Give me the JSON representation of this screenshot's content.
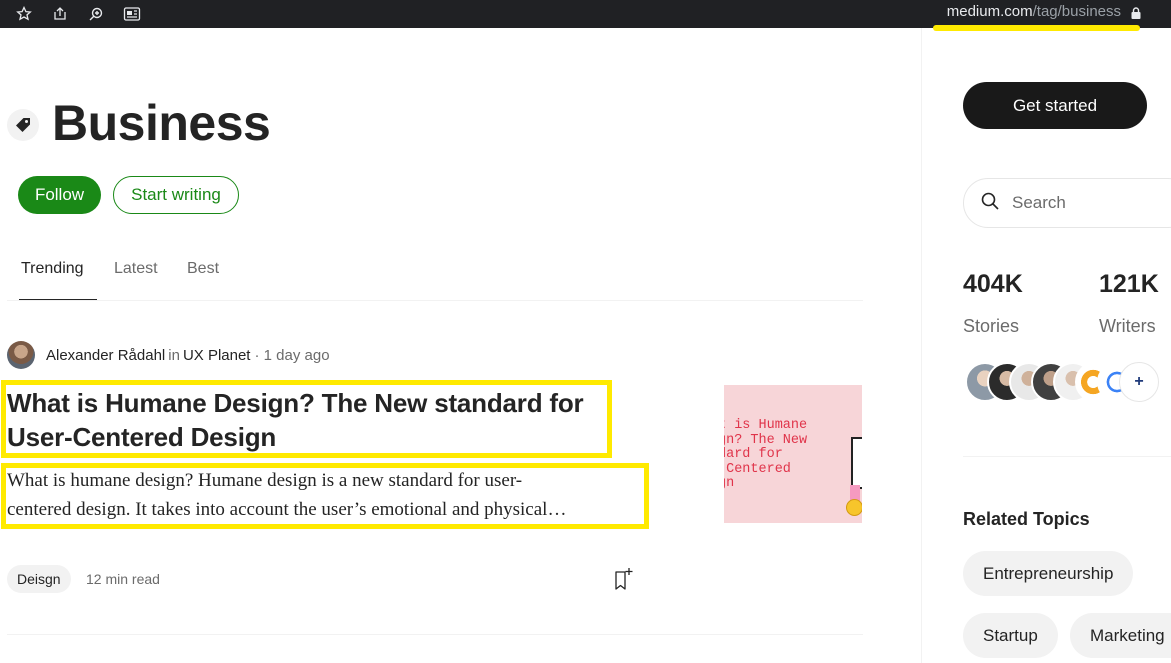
{
  "browser": {
    "url_domain": "medium.com",
    "url_path": "/tag/business",
    "icons": [
      "star-icon",
      "share-icon",
      "zoom-icon",
      "reader-icon",
      "lock-icon"
    ]
  },
  "tag": {
    "title": "Business",
    "follow_label": "Follow",
    "start_writing_label": "Start writing"
  },
  "tabs": [
    {
      "label": "Trending",
      "active": true
    },
    {
      "label": "Latest",
      "active": false
    },
    {
      "label": "Best",
      "active": false
    }
  ],
  "post": {
    "author": "Alexander Rådahl",
    "in_label": "in",
    "publication": "UX Planet",
    "date": "· 1 day ago",
    "title": "What is Humane Design? The New standard for User-Centered Design",
    "subtitle_line1": "What is humane design? Humane design is a new standard for user-",
    "subtitle_line2": "centered design. It takes into account the user’s emotional and physical…",
    "thumbnail_text": "t is Humane\ngn? The New\ndard for\n-Centered\ngn",
    "tag_chip": "Deisgn",
    "read_time": "12 min read"
  },
  "sidebar": {
    "get_started_label": "Get started",
    "search_placeholder": "Search",
    "stats": [
      {
        "value": "404K",
        "label": "Stories"
      },
      {
        "value": "121K",
        "label": "Writers"
      }
    ],
    "related_heading": "Related Topics",
    "topics": [
      "Entrepreneurship",
      "Startup",
      "Marketing"
    ]
  },
  "colors": {
    "brand_green": "#1a8917",
    "highlight_yellow": "#ffea00",
    "dark_button": "#191919"
  }
}
